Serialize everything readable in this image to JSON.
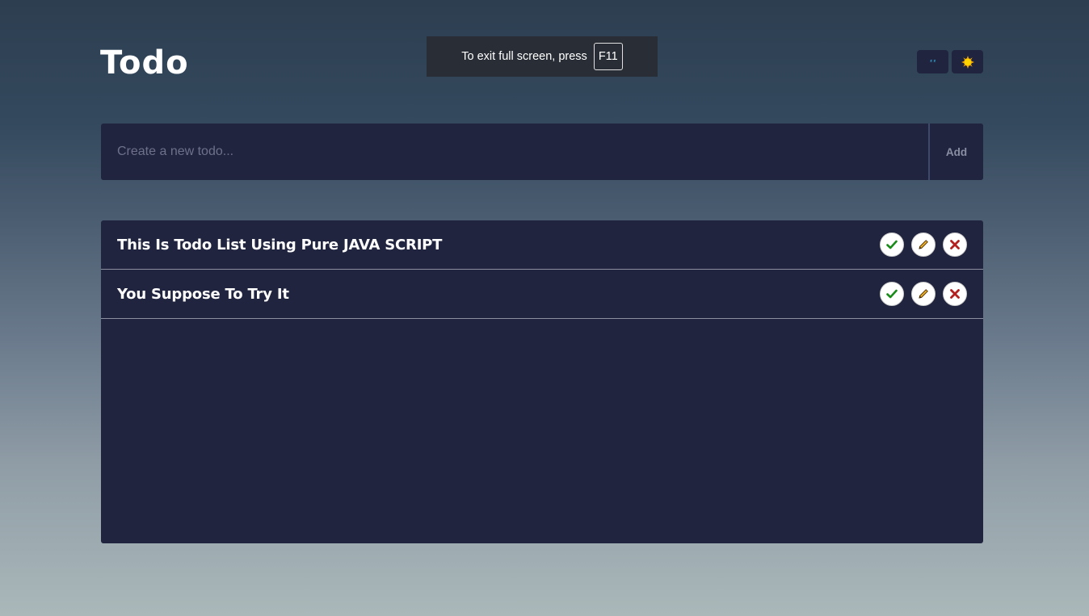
{
  "app": {
    "title": "Todo"
  },
  "fullscreen_notice": {
    "text": "To exit full screen, press",
    "key": "F11"
  },
  "theme_toggles": [
    {
      "name": "dark-mode",
      "icon": "sleep-icon",
      "glyph": "ᶻᶻ",
      "color": "#37b5e6"
    },
    {
      "name": "light-mode",
      "icon": "sun-icon",
      "color": "#ffd400"
    }
  ],
  "form": {
    "placeholder": "Create a new todo...",
    "value": "",
    "add_label": "Add"
  },
  "todos": [
    {
      "text": "This Is Todo List Using Pure JAVA SCRIPT"
    },
    {
      "text": "You Suppose To Try It"
    }
  ],
  "actions": [
    {
      "name": "complete",
      "icon": "check-icon",
      "color": "#1a8a1a"
    },
    {
      "name": "edit",
      "icon": "pencil-icon",
      "color": "#e8a317"
    },
    {
      "name": "delete",
      "icon": "close-icon",
      "color": "#b32020"
    }
  ],
  "colors": {
    "panel": "#20243f",
    "text": "#ffffff",
    "divider": "#8b8f9e"
  }
}
